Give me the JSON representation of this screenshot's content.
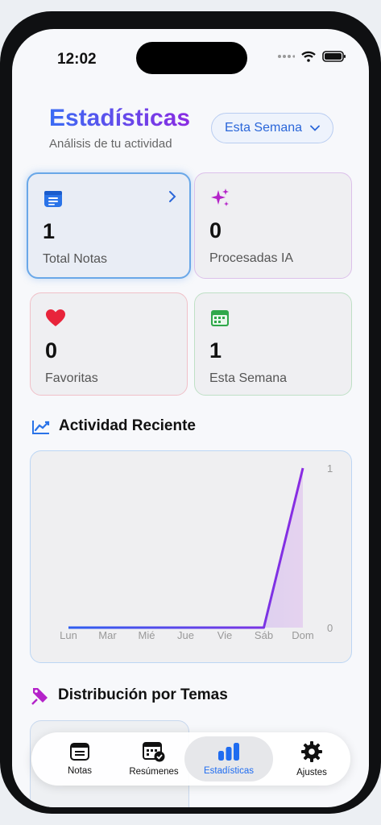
{
  "status_bar": {
    "time": "12:02"
  },
  "header": {
    "title": "Estadísticas",
    "subtitle": "Análisis de tu actividad",
    "period_select": "Esta Semana"
  },
  "cards": {
    "total_notes": {
      "value": "1",
      "label": "Total Notas"
    },
    "processed_ai": {
      "value": "0",
      "label": "Procesadas IA"
    },
    "favorites": {
      "value": "0",
      "label": "Favoritas"
    },
    "this_week": {
      "value": "1",
      "label": "Esta Semana"
    }
  },
  "activity": {
    "title": "Actividad Reciente"
  },
  "distribution": {
    "title": "Distribución por Temas"
  },
  "tabs": {
    "notes": "Notas",
    "summaries": "Resúmenes",
    "stats": "Estadísticas",
    "settings": "Ajustes"
  },
  "colors": {
    "accent": "#1f6cf0",
    "title_start": "#3a6cf4",
    "title_end": "#8a2be2",
    "favorite": "#e8243b",
    "week": "#2fa84a",
    "sparkle": "#b423c9"
  },
  "chart_data": {
    "type": "area",
    "categories": [
      "Lun",
      "Mar",
      "Mié",
      "Jue",
      "Vie",
      "Sáb",
      "Dom"
    ],
    "values": [
      0,
      0,
      0,
      0,
      0,
      0,
      1
    ],
    "y_ticks": [
      "0",
      "1"
    ],
    "ylim": [
      0,
      1
    ],
    "grid": false
  }
}
